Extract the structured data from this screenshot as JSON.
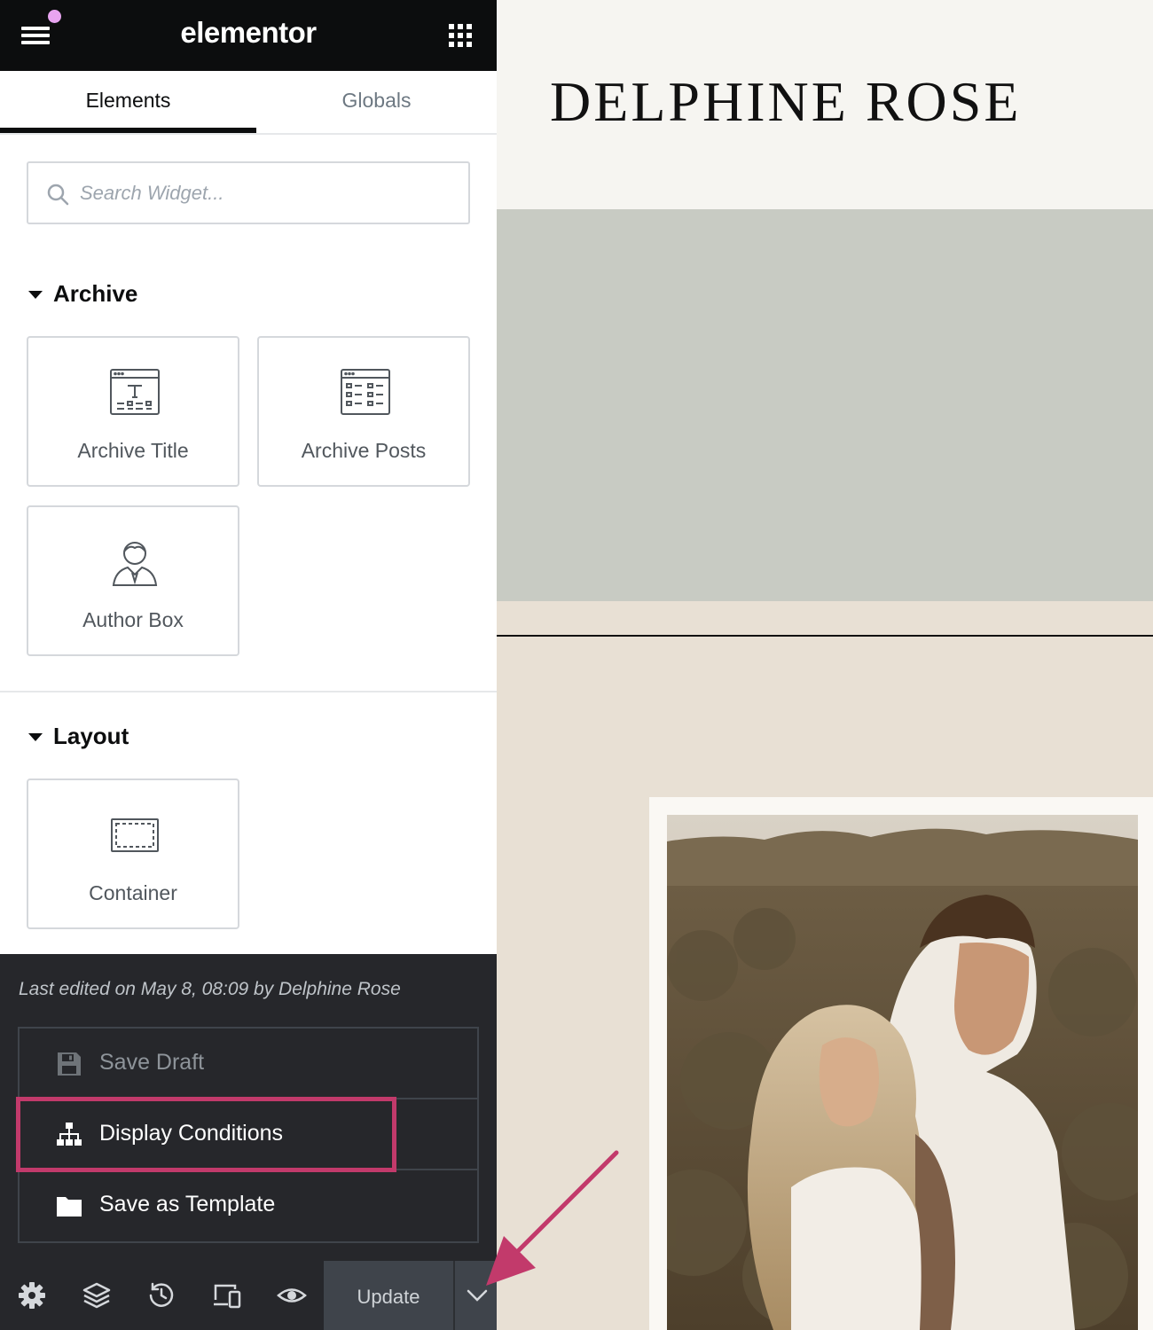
{
  "header": {
    "brand": "elementor",
    "menu_icon": "hamburger-icon",
    "apps_icon": "grid-icon",
    "notification_color": "#e8a4f0"
  },
  "tabs": [
    {
      "label": "Elements",
      "active": true
    },
    {
      "label": "Globals",
      "active": false
    }
  ],
  "search": {
    "placeholder": "Search Widget...",
    "value": ""
  },
  "categories": {
    "archive": {
      "title": "Archive",
      "widgets": [
        {
          "label": "Archive Title",
          "icon": "archive-title-icon"
        },
        {
          "label": "Archive Posts",
          "icon": "archive-posts-icon"
        },
        {
          "label": "Author Box",
          "icon": "author-box-icon"
        }
      ]
    },
    "layout": {
      "title": "Layout",
      "widgets": [
        {
          "label": "Container",
          "icon": "container-icon"
        }
      ]
    }
  },
  "footer": {
    "last_edited": "Last edited on May 8, 08:09 by Delphine Rose",
    "menu": [
      {
        "label": "Save Draft",
        "icon": "save-icon",
        "enabled": false
      },
      {
        "label": "Display Conditions",
        "icon": "sitemap-icon",
        "enabled": true,
        "highlighted": true
      },
      {
        "label": "Save as Template",
        "icon": "folder-icon",
        "enabled": true
      }
    ],
    "toolbar": {
      "icons": [
        "settings-icon",
        "layers-icon",
        "history-icon",
        "responsive-icon",
        "preview-icon"
      ],
      "update_label": "Update"
    }
  },
  "preview": {
    "site_title": "DELPHINE ROSE",
    "colors": {
      "background": "#f6f5f1",
      "hero": "#c8cbc3",
      "section": "#e8e0d4",
      "accent": "#c23a6b"
    }
  }
}
